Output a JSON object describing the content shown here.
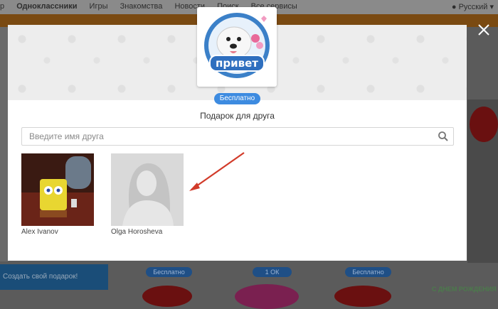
{
  "background": {
    "nav": [
      "р",
      "Одноклассники",
      "Игры",
      "Знакомства",
      "Новости",
      "Поиск",
      "Все сервисы"
    ],
    "lang": "Русский",
    "panel_text": "Создать свой подарок!",
    "buttons": [
      "Бесплатно",
      "1 ОК",
      "Бесплатно"
    ],
    "banner_text": "С ДНЕМ РОЖДЕНИЯ"
  },
  "modal": {
    "price_label": "Бесплатно",
    "title": "Подарок для друга",
    "search_placeholder": "Введите имя друга",
    "friends": [
      {
        "name": "Alex Ivanov"
      },
      {
        "name": "Olga Horosheva"
      }
    ]
  },
  "colors": {
    "accent": "#3d8be0",
    "annotation_arrow": "#d23b2a"
  },
  "icons": {
    "close": "close-icon",
    "search": "search-icon",
    "arrow": "arrow-annotation"
  }
}
